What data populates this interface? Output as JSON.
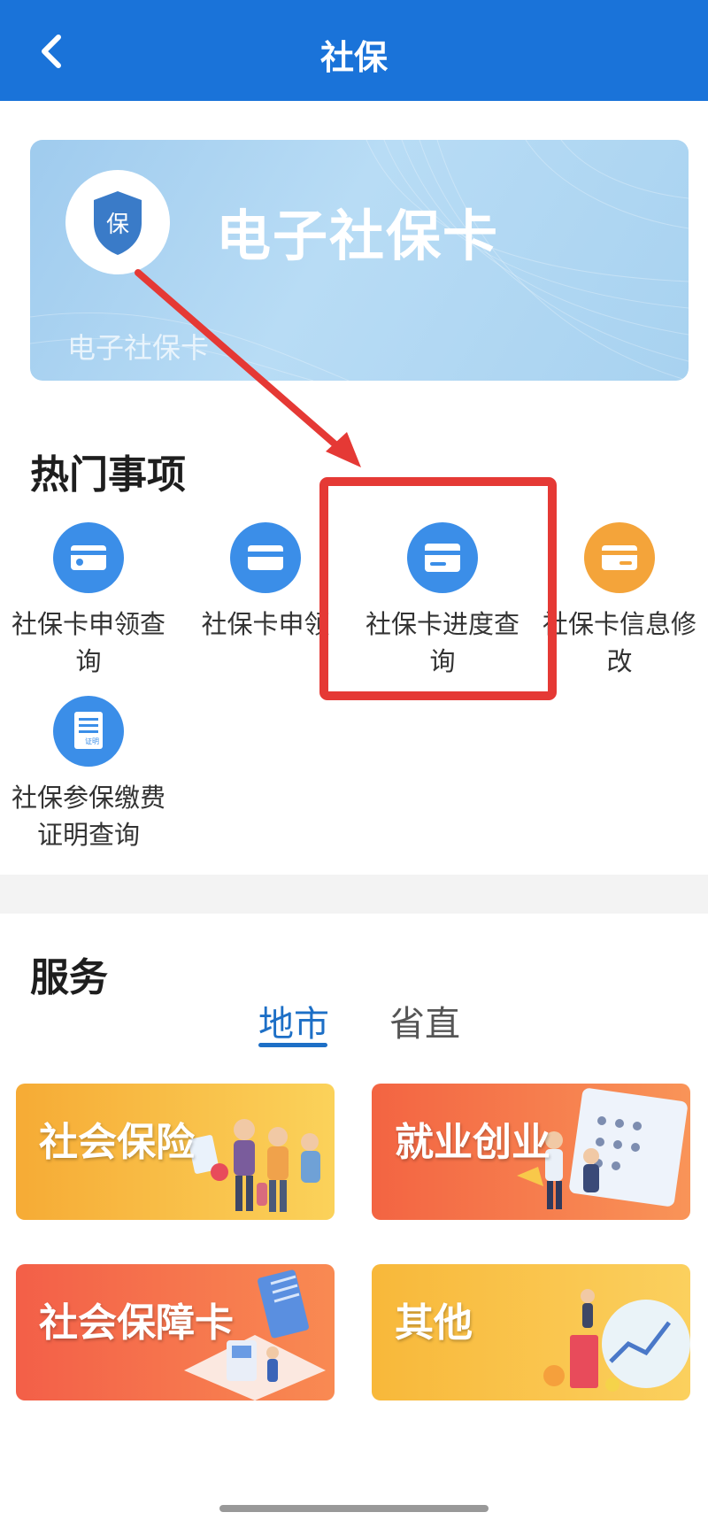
{
  "header": {
    "title": "社保",
    "back_icon": "chevron-left-icon"
  },
  "card": {
    "title": "电子社保卡",
    "subtitle": "电子社保卡",
    "logo_text": "保"
  },
  "hot": {
    "title": "热门事项",
    "items": [
      {
        "label": "社保卡申领查询",
        "icon": "card-icon",
        "color": "#3b8ee8"
      },
      {
        "label": "社保卡申领",
        "icon": "card-icon",
        "color": "#3b8ee8"
      },
      {
        "label": "社保卡进度查询",
        "icon": "card-progress-icon",
        "color": "#3b8ee8"
      },
      {
        "label": "社保卡信息修改",
        "icon": "card-edit-icon",
        "color": "#f4a43a"
      },
      {
        "label": "社保参保缴费证明查询",
        "icon": "certificate-icon",
        "color": "#3b8ee8",
        "badge": "证明"
      }
    ]
  },
  "services": {
    "title": "服务",
    "tabs": [
      {
        "label": "地市",
        "active": true
      },
      {
        "label": "省直",
        "active": false
      }
    ],
    "tiles": [
      {
        "label": "社会保险",
        "color": "#f8b43c"
      },
      {
        "label": "就业创业",
        "color": "#f57042"
      },
      {
        "label": "社会保障卡",
        "color": "#f46b4b"
      },
      {
        "label": "其他",
        "color": "#f9c244"
      }
    ]
  },
  "colors": {
    "header": "#1a73d9",
    "annotation": "#e53935",
    "tab_active": "#1d6fc6"
  }
}
